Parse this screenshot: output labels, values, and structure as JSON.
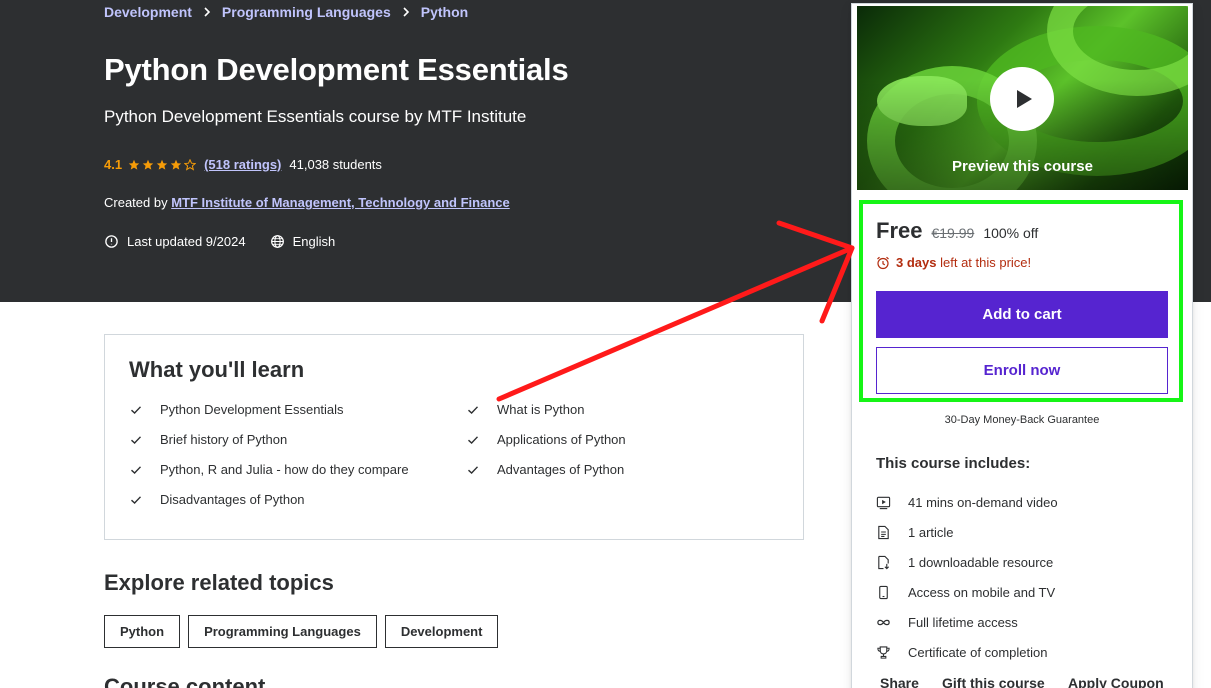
{
  "breadcrumb": {
    "items": [
      "Development",
      "Programming Languages",
      "Python"
    ]
  },
  "course": {
    "title": "Python Development Essentials",
    "subtitle": "Python Development Essentials course by MTF Institute",
    "rating": "4.1",
    "rating_value": 4.1,
    "ratings_count": "(518 ratings)",
    "students": "41,038 students",
    "created_by_label": "Created by",
    "author": "MTF Institute of Management, Technology and Finance",
    "last_updated": "Last updated 9/2024",
    "language": "English"
  },
  "learn": {
    "title": "What you'll learn",
    "items": [
      "Python Development Essentials",
      "What is Python",
      "Brief history of Python",
      "Applications of Python",
      "Python, R and Julia - how do they compare",
      "Advantages of Python",
      "Disadvantages of Python"
    ]
  },
  "explore": {
    "title": "Explore related topics",
    "topics": [
      "Python",
      "Programming Languages",
      "Development"
    ]
  },
  "next_section_title": "Course content",
  "sidebar": {
    "preview_label": "Preview this course",
    "price": "Free",
    "original_price": "€19.99",
    "discount": "100% off",
    "timer_bold": "3 days",
    "timer_rest": "left at this price!",
    "add_to_cart": "Add to cart",
    "enroll_now": "Enroll now",
    "guarantee": "30-Day Money-Back Guarantee",
    "includes_title": "This course includes:",
    "includes": [
      {
        "icon": "video-icon",
        "text": "41 mins on-demand video"
      },
      {
        "icon": "article-icon",
        "text": "1 article"
      },
      {
        "icon": "download-icon",
        "text": "1 downloadable resource"
      },
      {
        "icon": "mobile-icon",
        "text": "Access on mobile and TV"
      },
      {
        "icon": "infinity-icon",
        "text": "Full lifetime access"
      },
      {
        "icon": "trophy-icon",
        "text": "Certificate of completion"
      }
    ],
    "links": [
      "Share",
      "Gift this course",
      "Apply Coupon"
    ]
  },
  "colors": {
    "header_bg": "#2d2f31",
    "link_purple_light": "#c0c4fc",
    "brand_purple": "#5624d0",
    "star_orange": "#f69c08",
    "timer_red": "#b32d0f",
    "annotation_green": "#16f516",
    "annotation_red": "#ff1a1a"
  }
}
